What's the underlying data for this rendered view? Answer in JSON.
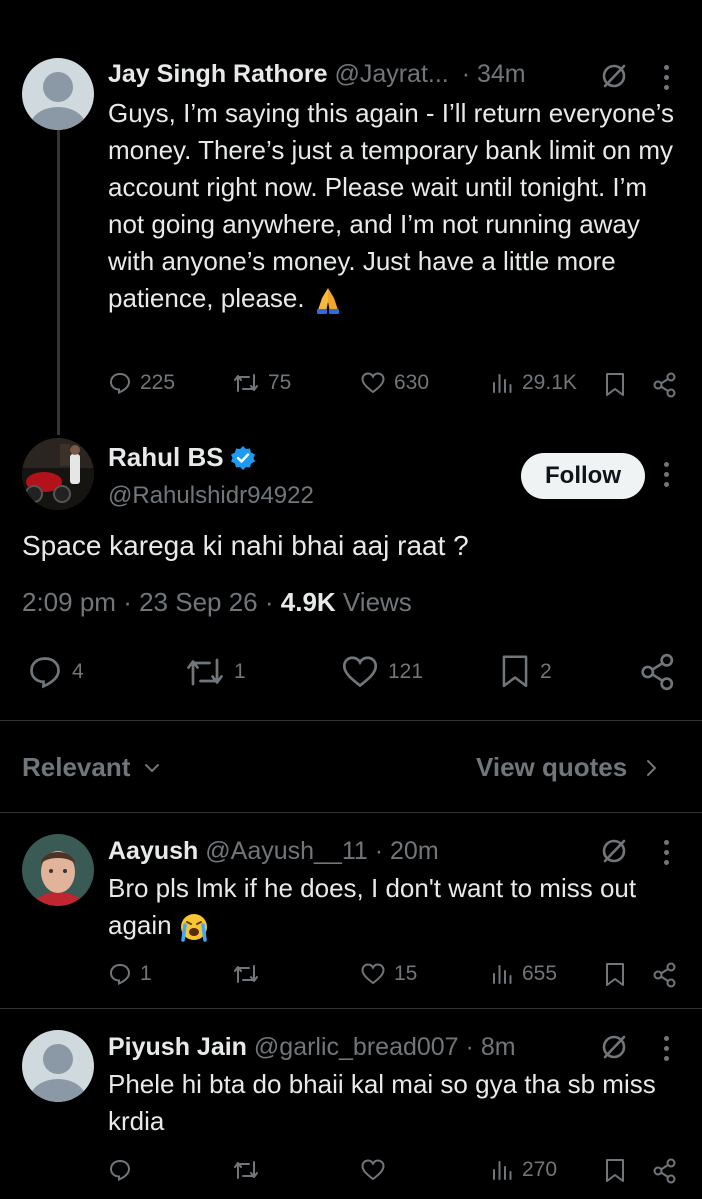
{
  "parent_tweet": {
    "name": "Jay Singh Rathore",
    "handle": "@Jayrat...",
    "time": "· 34m",
    "text": "Guys, I’m saying this again - I’ll return everyone’s money. There’s just a temporary bank limit on my account right now. Please wait until tonight. I’m not going anywhere, and I’m not running away with anyone’s money. Just have a little more patience, please.",
    "emoji": "folded-hands",
    "replies": "225",
    "reposts": "75",
    "likes": "630",
    "views": "29.1K"
  },
  "main_tweet": {
    "name": "Rahul BS",
    "handle": "@Rahulshidr94922",
    "verified": true,
    "follow_label": "Follow",
    "text": "Space karega ki nahi bhai aaj raat ?",
    "time": "2:09 pm",
    "date": "23 Sep 26",
    "views_count": "4.9K",
    "views_label": "Views",
    "replies": "4",
    "reposts": "1",
    "likes": "121",
    "bookmarks": "2"
  },
  "sort_bar": {
    "relevant_label": "Relevant",
    "view_quotes_label": "View quotes"
  },
  "replies": [
    {
      "name": "Aayush",
      "handle": "@Aayush__11",
      "time": "· 20m",
      "text": "Bro pls lmk if he does, I don't want to miss out again",
      "emoji": "loudly-crying-face",
      "replies": "1",
      "reposts": "",
      "likes": "15",
      "views": "655"
    },
    {
      "name": "Piyush Jain",
      "handle": "@garlic_bread007",
      "time": "· 8m",
      "text": "Phele hi bta do bhaii kal mai so gya tha sb miss krdia",
      "replies": "",
      "reposts": "",
      "likes": "",
      "views": "270"
    }
  ],
  "colors": {
    "background": "#000000",
    "text": "#e7e9ea",
    "secondary": "#71767b",
    "verified": "#1d9bf0",
    "divider": "#2f3336"
  }
}
